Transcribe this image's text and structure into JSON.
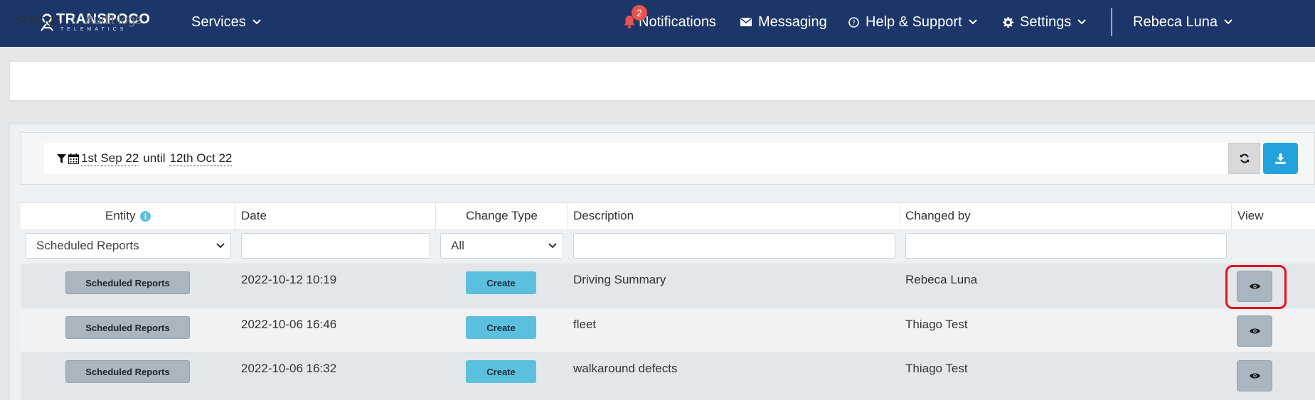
{
  "brand": {
    "name": "TRANSPOCO",
    "sub": "TELEMATICS"
  },
  "nav": {
    "services": "Services",
    "notifications": "Notifications",
    "notification_count": "2",
    "messaging": "Messaging",
    "help": "Help & Support",
    "settings": "Settings",
    "user": "Rebeca Luna"
  },
  "breadcrumb": {
    "root": "Settings",
    "separator": "/",
    "current": "Audit logs"
  },
  "filter": {
    "from": "1st Sep 22",
    "until_label": "until",
    "to": "12th Oct 22"
  },
  "table": {
    "headers": {
      "entity": "Entity",
      "date": "Date",
      "change_type": "Change Type",
      "description": "Description",
      "changed_by": "Changed by",
      "view": "View"
    },
    "filters": {
      "entity_selected": "Scheduled Reports",
      "change_type_selected": "All"
    },
    "rows": [
      {
        "entity": "Scheduled Reports",
        "date": "2022-10-12 10:19",
        "change_type": "Create",
        "description": "Driving Summary",
        "changed_by": "Rebeca Luna"
      },
      {
        "entity": "Scheduled Reports",
        "date": "2022-10-06 16:46",
        "change_type": "Create",
        "description": "fleet",
        "changed_by": "Thiago Test"
      },
      {
        "entity": "Scheduled Reports",
        "date": "2022-10-06 16:32",
        "change_type": "Create",
        "description": "walkaround defects",
        "changed_by": "Thiago Test"
      }
    ]
  },
  "colors": {
    "navbar": "#1c3669",
    "badge": "#e8534c",
    "download": "#23a3dc",
    "create_badge": "#5bc0de",
    "entity_badge": "#a9b6bf",
    "highlight": "#e0141b"
  }
}
